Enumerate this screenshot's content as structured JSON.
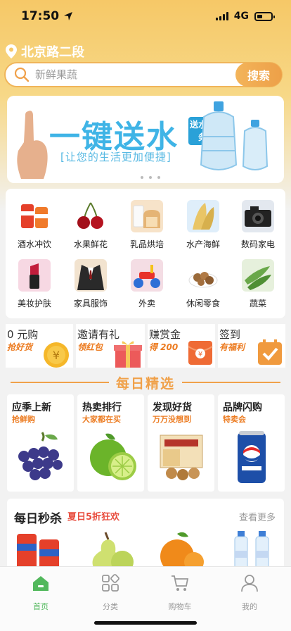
{
  "status": {
    "time": "17:50",
    "network": "4G"
  },
  "location": {
    "text": "北京路二段"
  },
  "search": {
    "placeholder": "新鲜果蔬",
    "button_label": "搜索"
  },
  "banner": {
    "title": "一键送水",
    "subtitle": "[让您的生活更加便捷]",
    "tag": "送水服务"
  },
  "categories": [
    {
      "label": "酒水冲饮",
      "icon": "soda-cans-icon"
    },
    {
      "label": "水果鲜花",
      "icon": "cherries-icon"
    },
    {
      "label": "乳品烘培",
      "icon": "bread-milk-icon"
    },
    {
      "label": "水产海鲜",
      "icon": "bamboo-shoot-icon"
    },
    {
      "label": "数码家电",
      "icon": "camera-icon"
    },
    {
      "label": "美妆护肤",
      "icon": "lipstick-icon"
    },
    {
      "label": "家具服饰",
      "icon": "suit-icon"
    },
    {
      "label": "外卖",
      "icon": "toy-bike-icon"
    },
    {
      "label": "休闲零食",
      "icon": "snacks-icon"
    },
    {
      "label": "蔬菜",
      "icon": "vegetables-icon"
    }
  ],
  "promos": [
    {
      "title": "0 元购",
      "subtitle": "抢好货"
    },
    {
      "title": "邀请有礼",
      "subtitle": "领红包"
    },
    {
      "title": "赚赏金",
      "subtitle": "得 200"
    },
    {
      "title": "签到",
      "subtitle": "有福利"
    }
  ],
  "daily_section": {
    "title": "每日精选"
  },
  "features": [
    {
      "title": "应季上新",
      "subtitle": "抢鲜购",
      "icon": "grapes-icon"
    },
    {
      "title": "热卖排行",
      "subtitle": "大家都在买",
      "icon": "lime-icon"
    },
    {
      "title": "发现好货",
      "subtitle": "万万没想到",
      "icon": "snack-box-icon"
    },
    {
      "title": "品牌闪购",
      "subtitle": "特卖会",
      "icon": "pepsi-can-icon"
    }
  ],
  "seckill": {
    "title": "每日秒杀",
    "subtitle": "夏日5折狂欢",
    "more": "查看更多",
    "items": [
      "soda-cans-icon",
      "pear-icon",
      "orange-icon",
      "water-bottles-icon"
    ]
  },
  "tabbar": [
    {
      "label": "首页",
      "active": true
    },
    {
      "label": "分类",
      "active": false
    },
    {
      "label": "购物车",
      "active": false
    },
    {
      "label": "我的",
      "active": false
    }
  ],
  "colors": {
    "accent": "#f0a14a",
    "active_tab": "#52b85c",
    "promo_text": "#ec7b20"
  }
}
